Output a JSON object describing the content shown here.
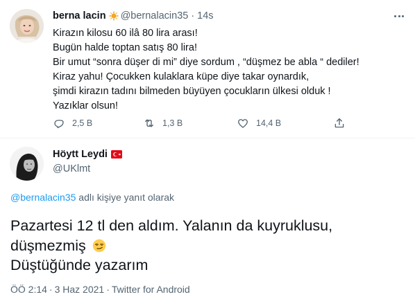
{
  "tweet1": {
    "name": "berna lacin",
    "verified_icon": "sun-emoji-icon",
    "handle": "@bernalacin35",
    "separator": "·",
    "time": "14s",
    "lines": [
      "Kirazın kilosu 60 ilâ 80 lira arası!",
      "Bugün halde toptan satış 80 lira!",
      "Bir umut “sonra düşer di mi” diye sordum , “düşmez be abla “ dediler!",
      "Kiraz yahu! Çocukken kulaklara küpe diye takar oynardık,",
      "şimdi kirazın tadını bilmeden büyüyen çocukların ülkesi olduk !",
      "Yazıklar olsun!"
    ],
    "actions": {
      "reply_count": "2,5 B",
      "retweet_count": "1,3 B",
      "like_count": "14,4 B"
    }
  },
  "tweet2": {
    "name": "Höytt Leydi",
    "flag_icon": "turkey-flag-icon",
    "handle": "@UKlmt",
    "reply_to": {
      "handle": "@bernalacin35",
      "text": " adlı kişiye yanıt olarak"
    },
    "lines": [
      "Pazartesi 12 tl den aldım. Yalanın da kuyruklusu,",
      "düşmezmiş",
      "Düştüğünde yazarım"
    ],
    "emoji": "smirking-face-emoji-icon",
    "meta": {
      "time": "ÖÖ 2:14",
      "date": "3 Haz 2021",
      "source": "Twitter for Android",
      "dot": "·"
    }
  },
  "colors": {
    "text": "#0f1419",
    "secondary": "#536471",
    "link": "#1d9bf0",
    "divider": "#eff3f4"
  }
}
